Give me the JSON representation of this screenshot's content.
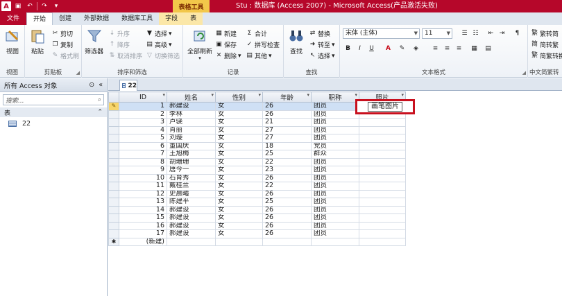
{
  "window": {
    "title": "Stu : 数据库 (Access 2007) - Microsoft Access(产品激活失败)",
    "context_tools": "表格工具"
  },
  "tabs": [
    "文件",
    "开始",
    "创建",
    "外部数据",
    "数据库工具",
    "字段",
    "表"
  ],
  "ribbon": {
    "views": {
      "view_label": "视图",
      "group_label": "视图"
    },
    "clipboard": {
      "paste": "粘贴",
      "cut": "剪切",
      "copy": "复制",
      "format_painter": "格式刷",
      "group_label": "剪贴板"
    },
    "sort_filter": {
      "filter": "筛选器",
      "ascending": "升序",
      "descending": "降序",
      "remove_sort": "取消排序",
      "selection": "选择",
      "advanced": "高级",
      "toggle_filter": "切换筛选",
      "group_label": "排序和筛选"
    },
    "records": {
      "refresh_all": "全部刷新",
      "new": "新建",
      "save": "保存",
      "delete": "删除",
      "totals": "合计",
      "spelling": "拼写检查",
      "more": "其他",
      "group_label": "记录"
    },
    "find": {
      "find": "查找",
      "replace": "替换",
      "goto": "转至",
      "select": "选择",
      "group_label": "查找"
    },
    "text_format": {
      "font": "宋体 (主体)",
      "size": "11",
      "bold": "B",
      "italic": "I",
      "underline": "U",
      "group_label": "文本格式"
    },
    "chinese": {
      "trad_to_simp": "繁转简",
      "simp_to_trad": "简转繁",
      "convert": "简繁转换",
      "group_label": "中文简繁转"
    }
  },
  "nav": {
    "header": "所有 Access 对象",
    "search_placeholder": "搜索...",
    "group": "表",
    "items": [
      "22"
    ]
  },
  "doc_tab": "22",
  "grid": {
    "columns": [
      "ID",
      "姓名",
      "性别",
      "年龄",
      "职称",
      "照片"
    ],
    "rows": [
      [
        "1",
        "郝建设",
        "女",
        "26",
        "团员"
      ],
      [
        "2",
        "李林",
        "女",
        "26",
        "团员"
      ],
      [
        "3",
        "卢骁",
        "女",
        "21",
        "团员"
      ],
      [
        "4",
        "肖丽",
        "女",
        "27",
        "团员"
      ],
      [
        "5",
        "刘璇",
        "女",
        "27",
        "团员"
      ],
      [
        "6",
        "董国庆",
        "女",
        "18",
        "党员"
      ],
      [
        "7",
        "王旭梅",
        "女",
        "25",
        "群众"
      ],
      [
        "8",
        "胡珊珊",
        "女",
        "22",
        "团员"
      ],
      [
        "9",
        "唐今一",
        "女",
        "23",
        "团员"
      ],
      [
        "10",
        "石育秀",
        "女",
        "26",
        "团员"
      ],
      [
        "11",
        "戴桂兰",
        "女",
        "22",
        "团员"
      ],
      [
        "12",
        "史晨曦",
        "女",
        "26",
        "团员"
      ],
      [
        "13",
        "陈建平",
        "女",
        "25",
        "团员"
      ],
      [
        "14",
        "郝建设",
        "女",
        "26",
        "团员"
      ],
      [
        "15",
        "郝建设",
        "女",
        "26",
        "团员"
      ],
      [
        "16",
        "郝建设",
        "女",
        "26",
        "团员"
      ],
      [
        "17",
        "郝建设",
        "女",
        "26",
        "团员"
      ]
    ],
    "new_row_label": "(新建)",
    "photo_cell_value": "画笔图片"
  }
}
